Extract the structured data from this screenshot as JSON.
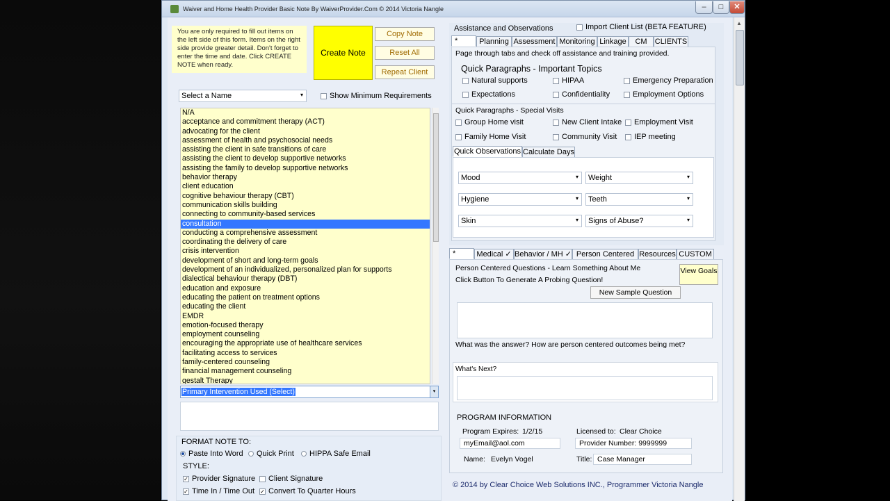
{
  "window": {
    "title": "Waiver and Home Health Provider Basic Note By WaiverProvider.Com © 2014 Victoria Nangle",
    "min_glyph": "–",
    "max_glyph": "□",
    "close_glyph": "✕"
  },
  "left": {
    "intro_text": "You are only required to fill out items on the left side of this form.  Items on the right side provide greater detail.  Don't forget to enter the time and date. Click CREATE NOTE when ready.",
    "create_note_label": "Create Note",
    "copy_note_label": "Copy Note",
    "reset_all_label": "Reset All",
    "repeat_client_label": "Repeat Client",
    "select_name_value": "Select a Name",
    "show_min_req_label": "Show Minimum Requirements",
    "interventions": [
      "N/A",
      "acceptance and commitment therapy (ACT)",
      "advocating for the client",
      "assessment of health and psychosocial needs",
      "assisting the client in safe transitions of care",
      "assisting the client to develop supportive networks",
      "assisting the family to develop supportive networks",
      "behavior therapy",
      "client education",
      "cognitive behaviour therapy (CBT)",
      "communication skills building",
      "connecting to community-based services",
      "consultation",
      "conducting a comprehensive assessment",
      "coordinating the delivery of care",
      "crisis intervention",
      "development of short and long-term goals",
      "development of an individualized, personalized plan for supports",
      "dialectical behaviour therapy (DBT)",
      "education and exposure",
      "educating the patient on treatment options",
      "educating the client",
      "EMDR",
      "emotion-focused therapy",
      "employment counseling",
      "encouraging the appropriate use of healthcare services",
      "facilitating access to services",
      "family-centered counseling",
      "financial management counseling",
      "gestalt Therapy"
    ],
    "selected_intervention_index": 12,
    "primary_intervention_value": "Primary Intervention Used (Select)",
    "format_note_label": "FORMAT NOTE TO:",
    "format_options": [
      "Paste Into Word",
      "Quick Print",
      "HIPPA Safe Email"
    ],
    "style_label": "STYLE:",
    "style_options": [
      {
        "label": "Provider Signature",
        "checked": true
      },
      {
        "label": "Client Signature",
        "checked": false
      },
      {
        "label": "Time In / Time Out",
        "checked": true
      },
      {
        "label": "Convert To Quarter Hours",
        "checked": true
      }
    ],
    "check_glyph": "✓",
    "caret": "▾"
  },
  "right": {
    "assist_header": "Assistance and Observations",
    "import_label": "Import Client List (BETA FEATURE)",
    "top_tabs": [
      "*",
      "Planning",
      "Assessment",
      "Monitoring",
      "Linkage",
      "CM",
      "CLIENTS"
    ],
    "page_through_text": "Page through tabs and check off assistance and training provided.",
    "quick_para_title": "Quick Paragraphs - Important Topics",
    "important_topics": [
      "Natural supports",
      "HIPAA",
      "Emergency Preparation",
      "Expectations",
      "Confidentiality",
      "Employment  Options"
    ],
    "special_visits_title": "Quick Paragraphs - Special Visits",
    "special_visits": [
      "Group Home visit",
      "New Client Intake",
      "Employment Visit",
      "Family Home Visit",
      "Community Visit",
      "IEP meeting"
    ],
    "obs_tabs": [
      "Quick Observations",
      "Calculate Days"
    ],
    "observations": [
      "Mood",
      "Weight",
      "Hygiene",
      "Teeth",
      "Skin",
      "Signs of Abuse?"
    ],
    "bottom_tabs": [
      "*",
      "Medical ✓",
      "Behavior / MH ✓",
      "Person Centered ✓",
      "Resources",
      "CUSTOM"
    ],
    "person_centered_title": "Person Centered Questions - Learn Something About Me",
    "click_button_text": "Click Button To Generate A Probing Question!",
    "view_goals_label": "View Goals",
    "new_sample_label": "New Sample Question",
    "answer_prompt": "What was the answer?  How are person centered outcomes being met?",
    "whats_next_label": "What's Next?",
    "program_info_title": "PROGRAM INFORMATION",
    "program_expires_label": "Program Expires:",
    "program_expires_value": "1/2/15",
    "licensed_to_label": "Licensed to:",
    "licensed_to_value": "Clear Choice",
    "email_value": "myEmail@aol.com",
    "provider_number_value": "Provider Number:  9999999",
    "name_label": "Name:",
    "name_value": "Evelyn Vogel",
    "title_label": "Title:",
    "title_value": "Case Manager",
    "footer": "© 2014 by Clear Choice Web Solutions INC., Programmer Victoria Nangle"
  }
}
